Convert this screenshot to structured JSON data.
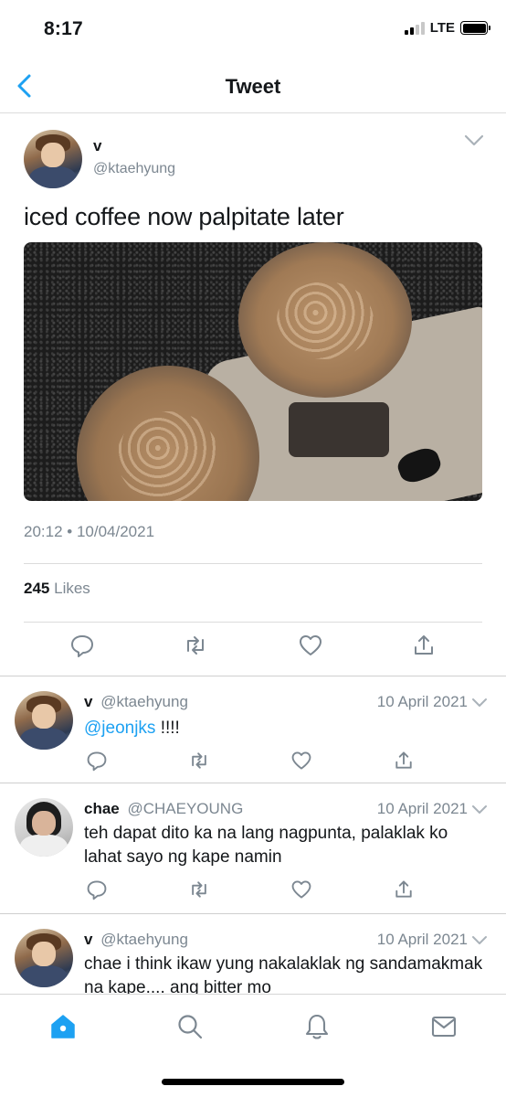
{
  "status_bar": {
    "time": "8:17",
    "network": "LTE"
  },
  "nav": {
    "title": "Tweet"
  },
  "main_tweet": {
    "name": "v",
    "handle": "@ktaehyung",
    "text": "iced coffee now palpitate later",
    "timestamp": "20:12 • 10/04/2021",
    "likes_count": "245",
    "likes_label": "Likes"
  },
  "replies": [
    {
      "name": "v",
      "handle": "@ktaehyung",
      "date": "10 April 2021",
      "mention": "@jeonjks",
      "text": " !!!!"
    },
    {
      "name": "chae",
      "handle": "@CHAEYOUNG",
      "date": "10 April 2021",
      "mention": "",
      "text": "teh dapat dito ka na lang nagpunta, palaklak ko lahat sayo ng kape namin"
    },
    {
      "name": "v",
      "handle": "@ktaehyung",
      "date": "10 April 2021",
      "mention": "",
      "text": "chae i think ikaw yung nakalaklak ng sandamakmak na kape.... ang bitter mo"
    }
  ],
  "colors": {
    "accent": "#1da1f2",
    "muted": "#7c8791",
    "text": "#14171a"
  },
  "icons": [
    "back-icon",
    "chevron-down-icon",
    "reply-icon",
    "retweet-icon",
    "like-icon",
    "share-icon",
    "home-icon",
    "search-icon",
    "notifications-icon",
    "messages-icon"
  ]
}
